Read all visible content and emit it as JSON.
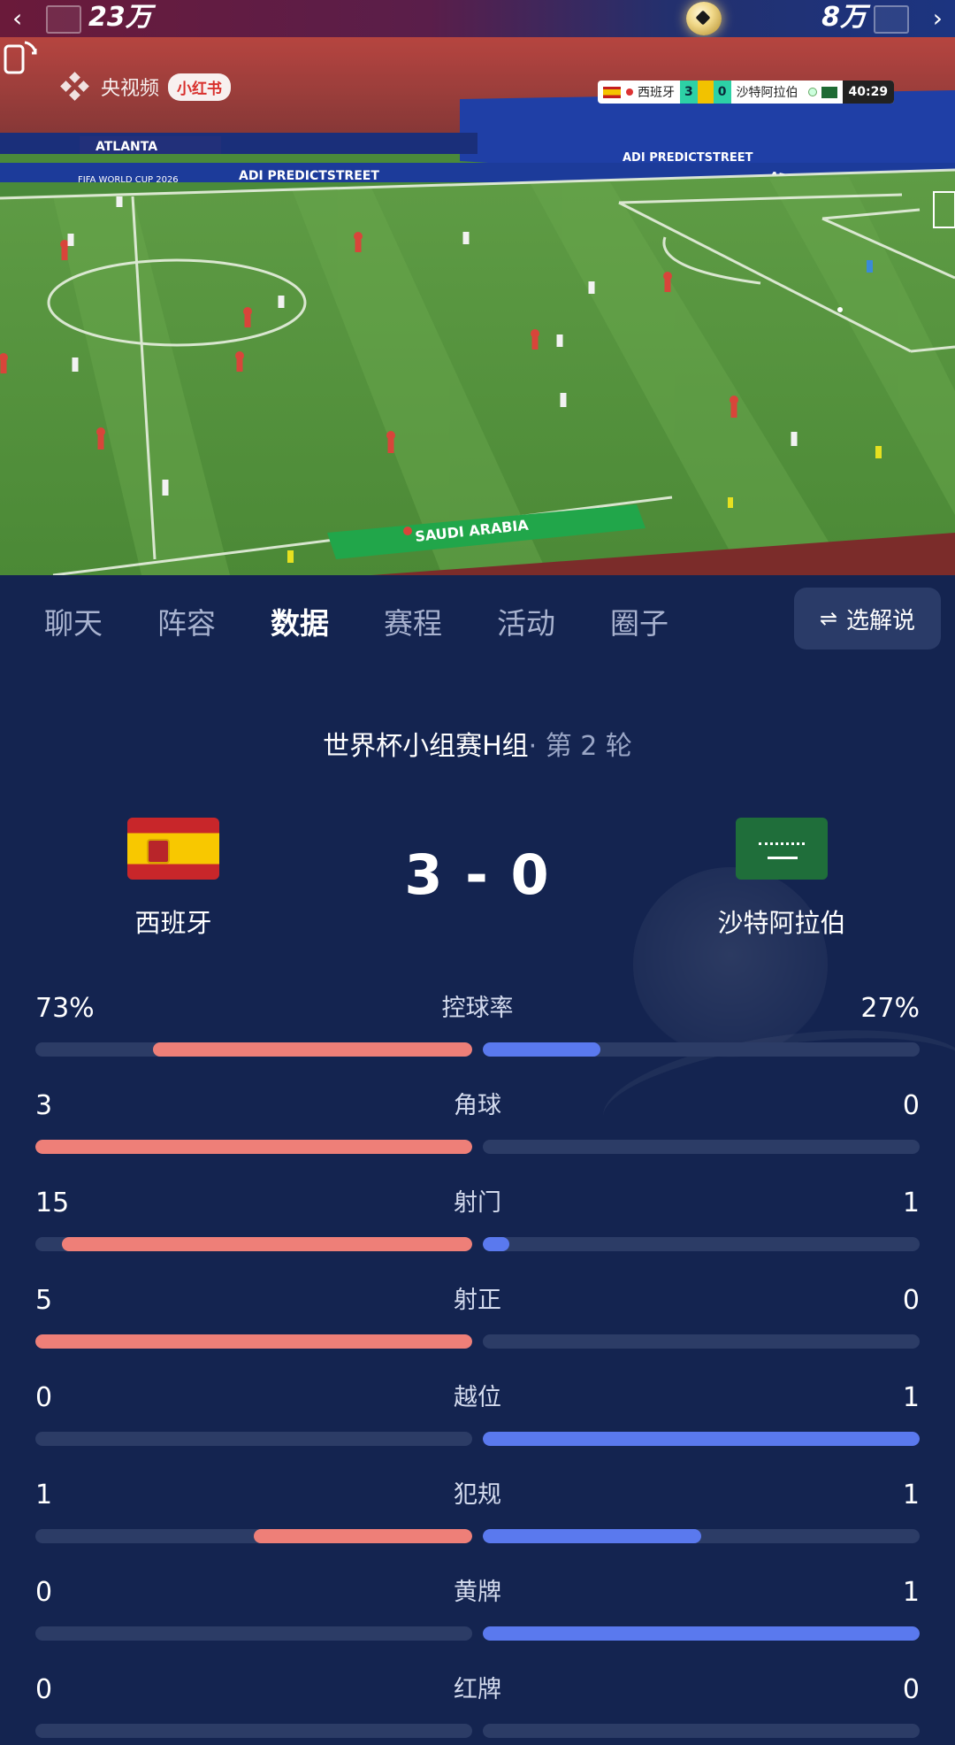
{
  "top_bar": {
    "home_votes": "23万",
    "away_votes": "8万",
    "back_icon": "chevron-left-icon",
    "forward_icon": "chevron-right-icon"
  },
  "video": {
    "broadcaster": "央视频",
    "source_badge": "小红书",
    "ad_boards": [
      "ATLANTA",
      "FIFA WORLD CUP 2026",
      "ADI PREDICTSTREET",
      "ADI PREDICTSTREET",
      "ADI PREDICTSTREET",
      "SAUDI ARABIA"
    ],
    "scorebug": {
      "home_team": "西班牙",
      "home_score": "3",
      "away_score": "0",
      "away_team": "沙特阿拉伯",
      "clock": "40:29"
    }
  },
  "tabs": [
    "聊天",
    "阵容",
    "数据",
    "赛程",
    "活动",
    "圈子"
  ],
  "active_tab": "数据",
  "select_commentary": "选解说",
  "match": {
    "competition": "世界杯小组赛H组",
    "round": "· 第 2 轮",
    "home_team": "西班牙",
    "away_team": "沙特阿拉伯",
    "score": "3 - 0"
  },
  "colors": {
    "background": "#142450",
    "home_bar": "#ee7f78",
    "away_bar": "#5a79ee",
    "track": "#2c3c66"
  },
  "stats": [
    {
      "label": "控球率",
      "home": "73%",
      "away": "27%",
      "home_share": 0.73,
      "away_share": 0.27
    },
    {
      "label": "角球",
      "home": "3",
      "away": "0",
      "home_share": 1.0,
      "away_share": 0.0
    },
    {
      "label": "射门",
      "home": "15",
      "away": "1",
      "home_share": 0.94,
      "away_share": 0.06
    },
    {
      "label": "射正",
      "home": "5",
      "away": "0",
      "home_share": 1.0,
      "away_share": 0.0
    },
    {
      "label": "越位",
      "home": "0",
      "away": "1",
      "home_share": 0.0,
      "away_share": 1.0
    },
    {
      "label": "犯规",
      "home": "1",
      "away": "1",
      "home_share": 0.5,
      "away_share": 0.5
    },
    {
      "label": "黄牌",
      "home": "0",
      "away": "1",
      "home_share": 0.0,
      "away_share": 1.0
    },
    {
      "label": "红牌",
      "home": "0",
      "away": "0",
      "home_share": 0.0,
      "away_share": 0.0
    }
  ]
}
